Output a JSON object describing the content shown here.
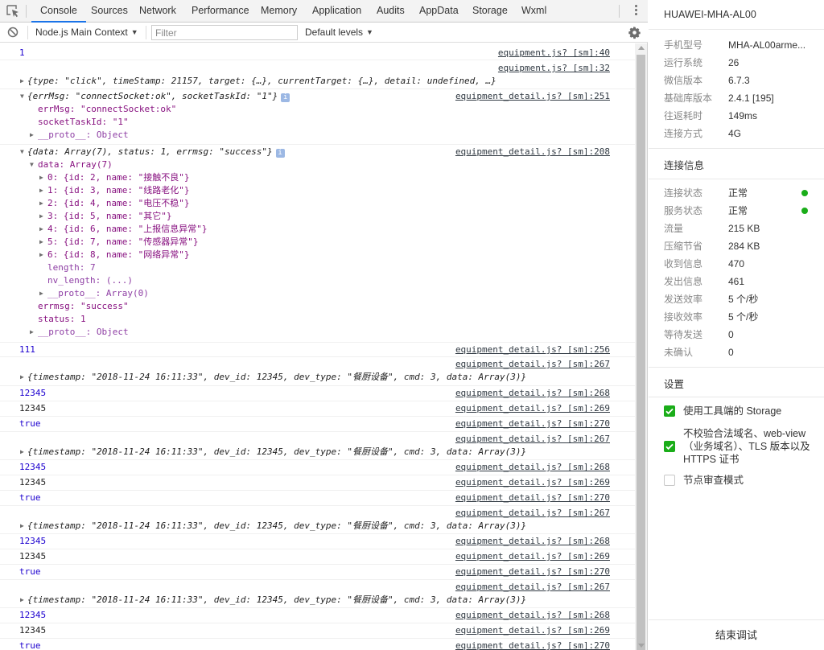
{
  "tabs": [
    "Console",
    "Sources",
    "Network",
    "Performance",
    "Memory",
    "Application",
    "Audits",
    "AppData",
    "Storage",
    "Wxml"
  ],
  "filterbar": {
    "context": "Node.js Main Context",
    "filter_placeholder": "Filter",
    "levels": "Default levels"
  },
  "console": {
    "r1": {
      "text": "1",
      "src": "equipment.js? [sm]:40"
    },
    "r2": {
      "src": "equipment.js? [sm]:32",
      "text": "{type: \"click\", timeStamp: 21157, target: {…}, currentTarget: {…}, detail: undefined, …}"
    },
    "r3": {
      "src": "equipment_detail.js? [sm]:251",
      "head": "{errMsg: \"connectSocket:ok\", socketTaskId: \"1\"}",
      "badge": "i",
      "l1": "errMsg: \"connectSocket:ok\"",
      "l2": "socketTaskId: \"1\"",
      "l3": "__proto__: Object"
    },
    "r4": {
      "src": "equipment_detail.js? [sm]:208",
      "head": "{data: Array(7), status: 1, errmsg: \"success\"}",
      "badge": "i",
      "data_label": "data: Array(7)",
      "items": [
        "0: {id: 2, name: \"接触不良\"}",
        "1: {id: 3, name: \"线路老化\"}",
        "2: {id: 4, name: \"电压不稳\"}",
        "3: {id: 5, name: \"其它\"}",
        "4: {id: 6, name: \"上报信息异常\"}",
        "5: {id: 7, name: \"传感器异常\"}",
        "6: {id: 8, name: \"网络异常\"}"
      ],
      "length": "length: 7",
      "nv_length": "nv_length: (...)",
      "proto_arr": "__proto__: Array(0)",
      "errmsg": "errmsg: \"success\"",
      "status": "status: 1",
      "proto_obj": "__proto__: Object"
    },
    "r5": {
      "text": "111",
      "src": "equipment_detail.js? [sm]:256"
    },
    "blocks": [
      {
        "src267": "equipment_detail.js? [sm]:267",
        "obj": "{timestamp: \"2018-11-24 16:11:33\", dev_id: 12345, dev_type: \"餐厨设备\", cmd: 3, data: Array(3)}",
        "v1": "12345",
        "src268": "equipment_detail.js? [sm]:268",
        "v2": "12345",
        "src269": "equipment_detail.js? [sm]:269",
        "v3": "true",
        "src270": "equipment_detail.js? [sm]:270"
      },
      {
        "src267": "equipment_detail.js? [sm]:267",
        "obj": "{timestamp: \"2018-11-24 16:11:33\", dev_id: 12345, dev_type: \"餐厨设备\", cmd: 3, data: Array(3)}",
        "v1": "12345",
        "src268": "equipment_detail.js? [sm]:268",
        "v2": "12345",
        "src269": "equipment_detail.js? [sm]:269",
        "v3": "true",
        "src270": "equipment_detail.js? [sm]:270"
      },
      {
        "src267": "equipment_detail.js? [sm]:267",
        "obj": "{timestamp: \"2018-11-24 16:11:33\", dev_id: 12345, dev_type: \"餐厨设备\", cmd: 3, data: Array(3)}",
        "v1": "12345",
        "src268": "equipment_detail.js? [sm]:268",
        "v2": "12345",
        "src269": "equipment_detail.js? [sm]:269",
        "v3": "true",
        "src270": "equipment_detail.js? [sm]:270"
      },
      {
        "src267": "equipment_detail.js? [sm]:267",
        "obj": "{timestamp: \"2018-11-24 16:11:33\", dev_id: 12345, dev_type: \"餐厨设备\", cmd: 3, data: Array(3)}",
        "v1": "12345",
        "src268": "equipment_detail.js? [sm]:268",
        "v2": "12345",
        "src269": "equipment_detail.js? [sm]:269",
        "v3": "true",
        "src270": "equipment_detail.js? [sm]:270"
      }
    ]
  },
  "device": {
    "name": "HUAWEI-MHA-AL00",
    "props": [
      {
        "k": "手机型号",
        "v": "MHA-AL00arme..."
      },
      {
        "k": "运行系统",
        "v": "26"
      },
      {
        "k": "微信版本",
        "v": "6.7.3"
      },
      {
        "k": "基础库版本",
        "v": "2.4.1 [195]"
      },
      {
        "k": "往返耗时",
        "v": "149ms"
      },
      {
        "k": "连接方式",
        "v": "4G"
      }
    ]
  },
  "connection": {
    "title": "连接信息",
    "props": [
      {
        "k": "连接状态",
        "v": "正常"
      },
      {
        "k": "服务状态",
        "v": "正常"
      },
      {
        "k": "流量",
        "v": "215 KB"
      },
      {
        "k": "压缩节省",
        "v": "284 KB"
      },
      {
        "k": "收到信息",
        "v": "470"
      },
      {
        "k": "发出信息",
        "v": "461"
      },
      {
        "k": "发送效率",
        "v": "5 个/秒"
      },
      {
        "k": "接收效率",
        "v": "5 个/秒"
      },
      {
        "k": "等待发送",
        "v": "0"
      },
      {
        "k": "未确认",
        "v": "0"
      }
    ],
    "ok_color": "#1aad19"
  },
  "settings": {
    "title": "设置",
    "opt1": "使用工具端的 Storage",
    "opt2": "不校验合法域名、web-view（业务域名）、TLS 版本以及 HTTPS 证书",
    "opt3": "节点审查模式",
    "opt1_checked": true,
    "opt2_checked": true,
    "opt3_checked": false
  },
  "end_button": "结束调试"
}
